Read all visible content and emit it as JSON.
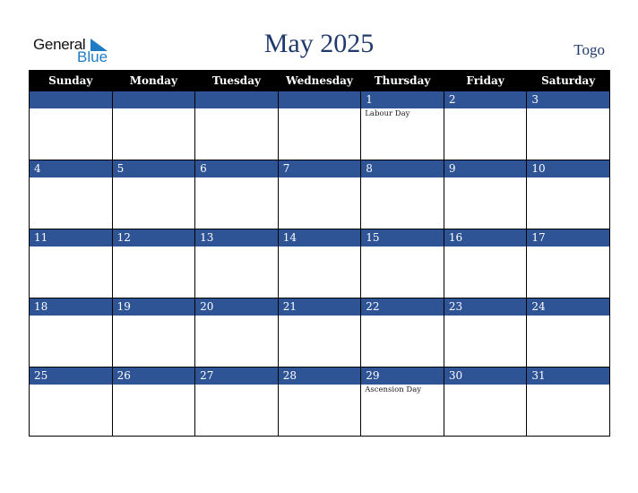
{
  "logo": {
    "line1": "General",
    "line2": "Blue"
  },
  "header": {
    "title": "May 2025",
    "country": "Togo"
  },
  "weekdays": [
    "Sunday",
    "Monday",
    "Tuesday",
    "Wednesday",
    "Thursday",
    "Friday",
    "Saturday"
  ],
  "weeks": [
    [
      {
        "day": "",
        "event": ""
      },
      {
        "day": "",
        "event": ""
      },
      {
        "day": "",
        "event": ""
      },
      {
        "day": "",
        "event": ""
      },
      {
        "day": "1",
        "event": "Labour Day"
      },
      {
        "day": "2",
        "event": ""
      },
      {
        "day": "3",
        "event": ""
      }
    ],
    [
      {
        "day": "4",
        "event": ""
      },
      {
        "day": "5",
        "event": ""
      },
      {
        "day": "6",
        "event": ""
      },
      {
        "day": "7",
        "event": ""
      },
      {
        "day": "8",
        "event": ""
      },
      {
        "day": "9",
        "event": ""
      },
      {
        "day": "10",
        "event": ""
      }
    ],
    [
      {
        "day": "11",
        "event": ""
      },
      {
        "day": "12",
        "event": ""
      },
      {
        "day": "13",
        "event": ""
      },
      {
        "day": "14",
        "event": ""
      },
      {
        "day": "15",
        "event": ""
      },
      {
        "day": "16",
        "event": ""
      },
      {
        "day": "17",
        "event": ""
      }
    ],
    [
      {
        "day": "18",
        "event": ""
      },
      {
        "day": "19",
        "event": ""
      },
      {
        "day": "20",
        "event": ""
      },
      {
        "day": "21",
        "event": ""
      },
      {
        "day": "22",
        "event": ""
      },
      {
        "day": "23",
        "event": ""
      },
      {
        "day": "24",
        "event": ""
      }
    ],
    [
      {
        "day": "25",
        "event": ""
      },
      {
        "day": "26",
        "event": ""
      },
      {
        "day": "27",
        "event": ""
      },
      {
        "day": "28",
        "event": ""
      },
      {
        "day": "29",
        "event": "Ascension Day"
      },
      {
        "day": "30",
        "event": ""
      },
      {
        "day": "31",
        "event": ""
      }
    ]
  ],
  "colors": {
    "header_bg": "#000000",
    "daybar_bg": "#2e5496",
    "title": "#1f3a6b",
    "logo_blue": "#1f7cc4"
  }
}
